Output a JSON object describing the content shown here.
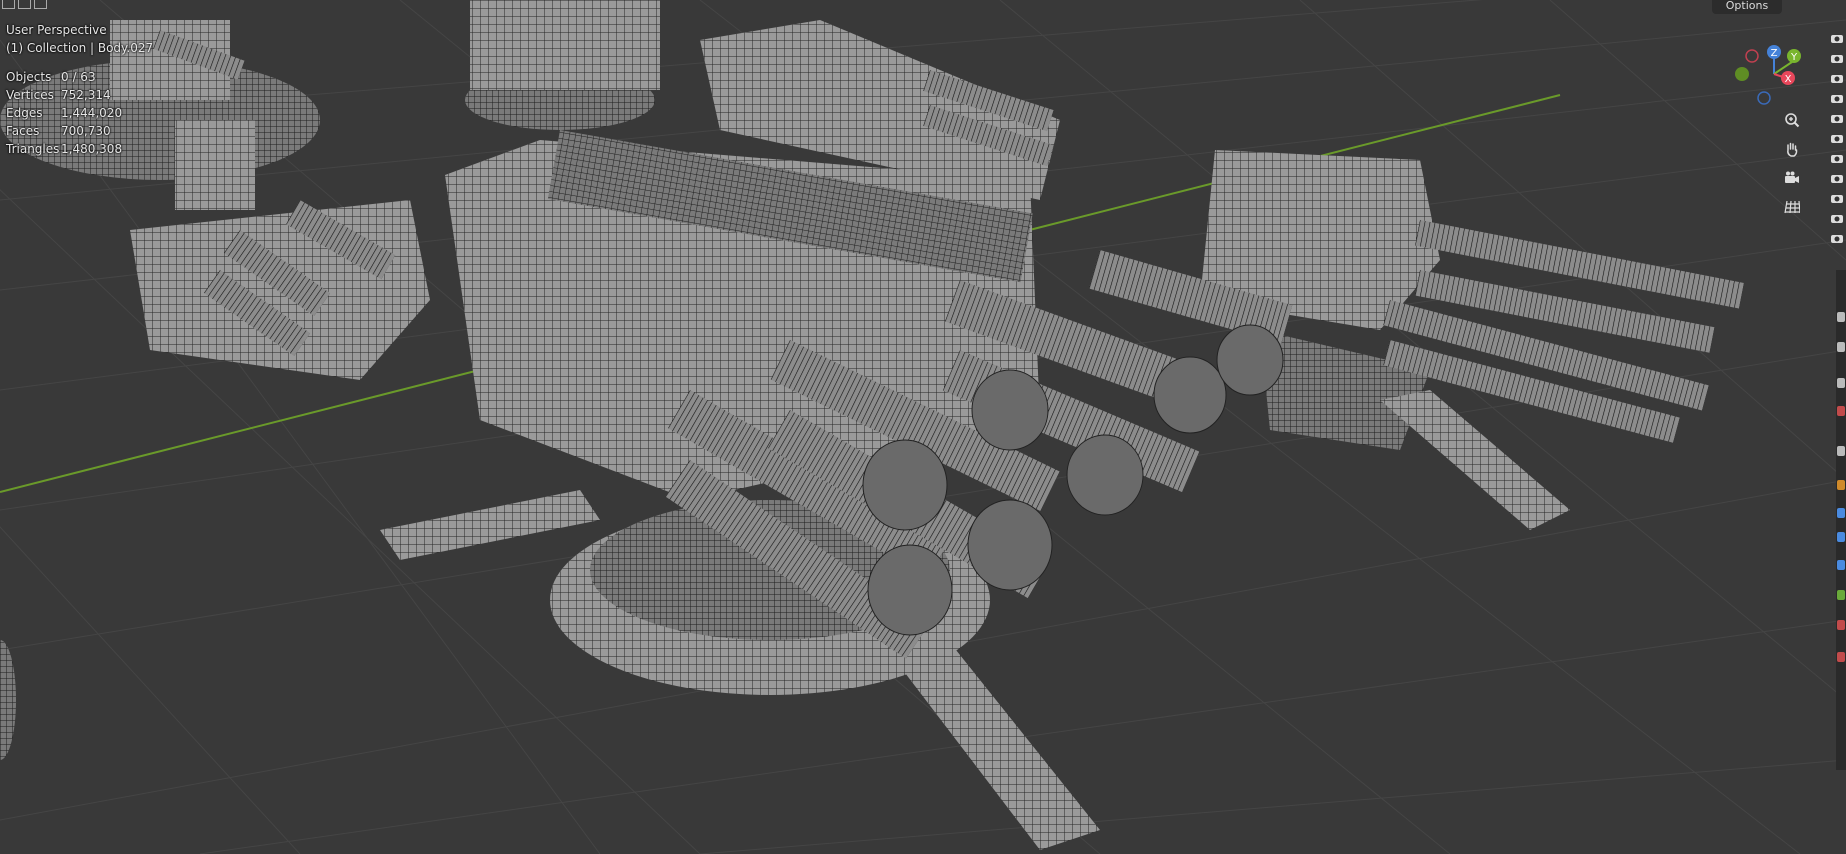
{
  "viewport": {
    "perspective_label": "User Perspective",
    "collection_label": "(1) Collection | Body.027"
  },
  "stats": [
    {
      "label": "Objects",
      "value": "0 / 63"
    },
    {
      "label": "Vertices",
      "value": "752,314"
    },
    {
      "label": "Edges",
      "value": "1,444,020"
    },
    {
      "label": "Faces",
      "value": "700,730"
    },
    {
      "label": "Triangles",
      "value": "1,480,308"
    }
  ],
  "header": {
    "options_label": "Options"
  },
  "gizmo": {
    "z_label": "Z",
    "y_label": "Y",
    "x_label": "X"
  },
  "navigation": [
    "zoom-icon",
    "hand-pan-icon",
    "camera-view-icon",
    "grid-ortho-icon"
  ],
  "colors": {
    "grid_bg": "#393939",
    "x_axis": "#e8475b",
    "y_axis": "#79b52e",
    "z_axis": "#4582d8"
  }
}
